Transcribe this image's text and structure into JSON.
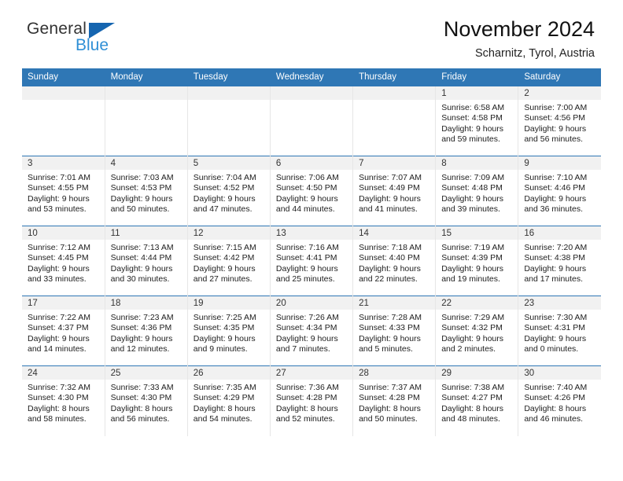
{
  "brand": {
    "name_top": "General",
    "name_bottom": "Blue",
    "colors": {
      "dark": "#333333",
      "blue": "#2f8fd6",
      "triangle": "#1565b0"
    }
  },
  "header": {
    "title": "November 2024",
    "subtitle": "Scharnitz, Tyrol, Austria"
  },
  "theme": {
    "header_bg": "#2f77b5",
    "header_text": "#ffffff",
    "daynum_bg": "#f1f1f1",
    "cell_bg": "#ffffff",
    "row_rule": "#2f77b5"
  },
  "calendar": {
    "weekday_headers": [
      "Sunday",
      "Monday",
      "Tuesday",
      "Wednesday",
      "Thursday",
      "Friday",
      "Saturday"
    ],
    "weeks": [
      [
        {
          "day": "",
          "lines": []
        },
        {
          "day": "",
          "lines": []
        },
        {
          "day": "",
          "lines": []
        },
        {
          "day": "",
          "lines": []
        },
        {
          "day": "",
          "lines": []
        },
        {
          "day": "1",
          "lines": [
            "Sunrise: 6:58 AM",
            "Sunset: 4:58 PM",
            "Daylight: 9 hours",
            "and 59 minutes."
          ]
        },
        {
          "day": "2",
          "lines": [
            "Sunrise: 7:00 AM",
            "Sunset: 4:56 PM",
            "Daylight: 9 hours",
            "and 56 minutes."
          ]
        }
      ],
      [
        {
          "day": "3",
          "lines": [
            "Sunrise: 7:01 AM",
            "Sunset: 4:55 PM",
            "Daylight: 9 hours",
            "and 53 minutes."
          ]
        },
        {
          "day": "4",
          "lines": [
            "Sunrise: 7:03 AM",
            "Sunset: 4:53 PM",
            "Daylight: 9 hours",
            "and 50 minutes."
          ]
        },
        {
          "day": "5",
          "lines": [
            "Sunrise: 7:04 AM",
            "Sunset: 4:52 PM",
            "Daylight: 9 hours",
            "and 47 minutes."
          ]
        },
        {
          "day": "6",
          "lines": [
            "Sunrise: 7:06 AM",
            "Sunset: 4:50 PM",
            "Daylight: 9 hours",
            "and 44 minutes."
          ]
        },
        {
          "day": "7",
          "lines": [
            "Sunrise: 7:07 AM",
            "Sunset: 4:49 PM",
            "Daylight: 9 hours",
            "and 41 minutes."
          ]
        },
        {
          "day": "8",
          "lines": [
            "Sunrise: 7:09 AM",
            "Sunset: 4:48 PM",
            "Daylight: 9 hours",
            "and 39 minutes."
          ]
        },
        {
          "day": "9",
          "lines": [
            "Sunrise: 7:10 AM",
            "Sunset: 4:46 PM",
            "Daylight: 9 hours",
            "and 36 minutes."
          ]
        }
      ],
      [
        {
          "day": "10",
          "lines": [
            "Sunrise: 7:12 AM",
            "Sunset: 4:45 PM",
            "Daylight: 9 hours",
            "and 33 minutes."
          ]
        },
        {
          "day": "11",
          "lines": [
            "Sunrise: 7:13 AM",
            "Sunset: 4:44 PM",
            "Daylight: 9 hours",
            "and 30 minutes."
          ]
        },
        {
          "day": "12",
          "lines": [
            "Sunrise: 7:15 AM",
            "Sunset: 4:42 PM",
            "Daylight: 9 hours",
            "and 27 minutes."
          ]
        },
        {
          "day": "13",
          "lines": [
            "Sunrise: 7:16 AM",
            "Sunset: 4:41 PM",
            "Daylight: 9 hours",
            "and 25 minutes."
          ]
        },
        {
          "day": "14",
          "lines": [
            "Sunrise: 7:18 AM",
            "Sunset: 4:40 PM",
            "Daylight: 9 hours",
            "and 22 minutes."
          ]
        },
        {
          "day": "15",
          "lines": [
            "Sunrise: 7:19 AM",
            "Sunset: 4:39 PM",
            "Daylight: 9 hours",
            "and 19 minutes."
          ]
        },
        {
          "day": "16",
          "lines": [
            "Sunrise: 7:20 AM",
            "Sunset: 4:38 PM",
            "Daylight: 9 hours",
            "and 17 minutes."
          ]
        }
      ],
      [
        {
          "day": "17",
          "lines": [
            "Sunrise: 7:22 AM",
            "Sunset: 4:37 PM",
            "Daylight: 9 hours",
            "and 14 minutes."
          ]
        },
        {
          "day": "18",
          "lines": [
            "Sunrise: 7:23 AM",
            "Sunset: 4:36 PM",
            "Daylight: 9 hours",
            "and 12 minutes."
          ]
        },
        {
          "day": "19",
          "lines": [
            "Sunrise: 7:25 AM",
            "Sunset: 4:35 PM",
            "Daylight: 9 hours",
            "and 9 minutes."
          ]
        },
        {
          "day": "20",
          "lines": [
            "Sunrise: 7:26 AM",
            "Sunset: 4:34 PM",
            "Daylight: 9 hours",
            "and 7 minutes."
          ]
        },
        {
          "day": "21",
          "lines": [
            "Sunrise: 7:28 AM",
            "Sunset: 4:33 PM",
            "Daylight: 9 hours",
            "and 5 minutes."
          ]
        },
        {
          "day": "22",
          "lines": [
            "Sunrise: 7:29 AM",
            "Sunset: 4:32 PM",
            "Daylight: 9 hours",
            "and 2 minutes."
          ]
        },
        {
          "day": "23",
          "lines": [
            "Sunrise: 7:30 AM",
            "Sunset: 4:31 PM",
            "Daylight: 9 hours",
            "and 0 minutes."
          ]
        }
      ],
      [
        {
          "day": "24",
          "lines": [
            "Sunrise: 7:32 AM",
            "Sunset: 4:30 PM",
            "Daylight: 8 hours",
            "and 58 minutes."
          ]
        },
        {
          "day": "25",
          "lines": [
            "Sunrise: 7:33 AM",
            "Sunset: 4:30 PM",
            "Daylight: 8 hours",
            "and 56 minutes."
          ]
        },
        {
          "day": "26",
          "lines": [
            "Sunrise: 7:35 AM",
            "Sunset: 4:29 PM",
            "Daylight: 8 hours",
            "and 54 minutes."
          ]
        },
        {
          "day": "27",
          "lines": [
            "Sunrise: 7:36 AM",
            "Sunset: 4:28 PM",
            "Daylight: 8 hours",
            "and 52 minutes."
          ]
        },
        {
          "day": "28",
          "lines": [
            "Sunrise: 7:37 AM",
            "Sunset: 4:28 PM",
            "Daylight: 8 hours",
            "and 50 minutes."
          ]
        },
        {
          "day": "29",
          "lines": [
            "Sunrise: 7:38 AM",
            "Sunset: 4:27 PM",
            "Daylight: 8 hours",
            "and 48 minutes."
          ]
        },
        {
          "day": "30",
          "lines": [
            "Sunrise: 7:40 AM",
            "Sunset: 4:26 PM",
            "Daylight: 8 hours",
            "and 46 minutes."
          ]
        }
      ]
    ]
  }
}
